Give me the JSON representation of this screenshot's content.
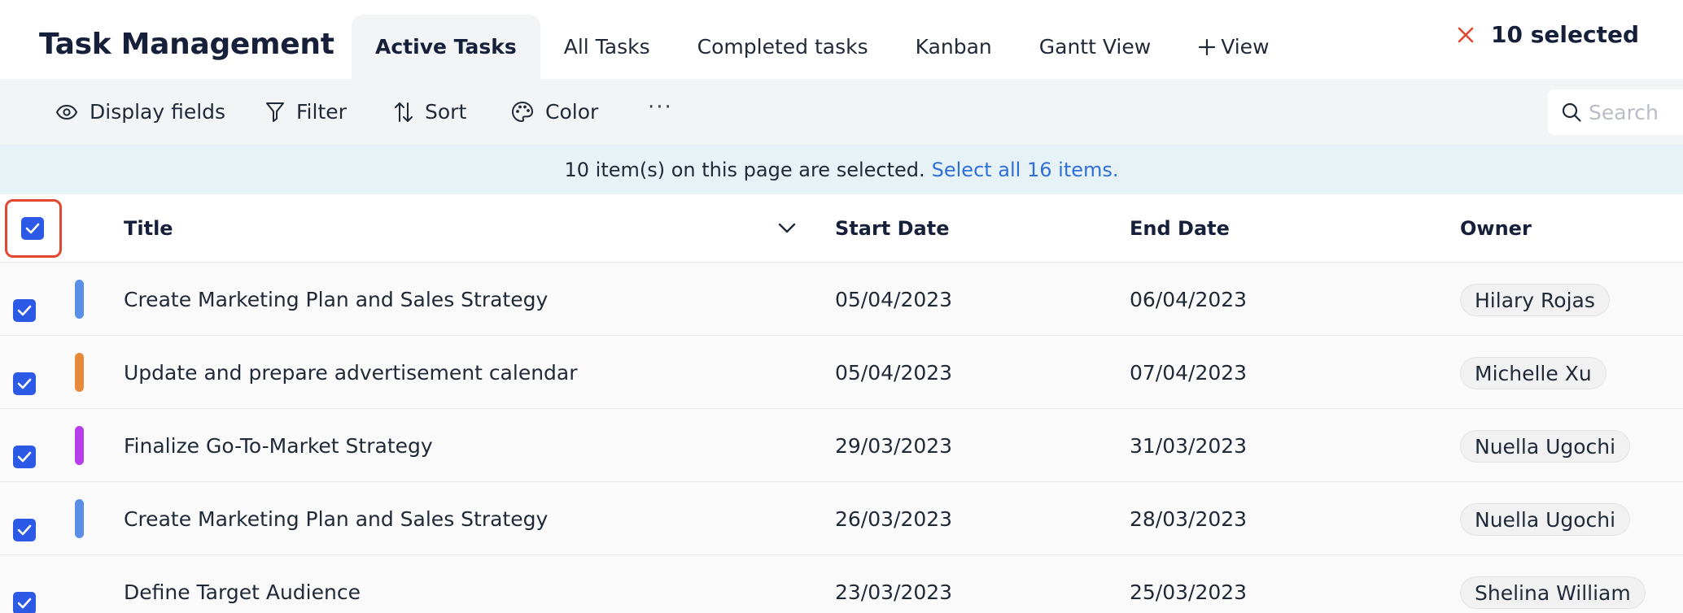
{
  "header": {
    "title": "Task Management",
    "tabs": [
      {
        "label": "Active Tasks",
        "active": true
      },
      {
        "label": "All Tasks",
        "active": false
      },
      {
        "label": "Completed tasks",
        "active": false
      },
      {
        "label": "Kanban",
        "active": false
      },
      {
        "label": "Gantt View",
        "active": false
      }
    ],
    "add_view_label": "View",
    "selected_text": "10 selected"
  },
  "toolbar": {
    "display_fields": "Display fields",
    "filter": "Filter",
    "sort": "Sort",
    "color": "Color",
    "more": "···",
    "search_placeholder": "Search"
  },
  "banner": {
    "text": "10 item(s) on this page are selected.",
    "link": "Select all 16 items."
  },
  "table": {
    "columns": {
      "title": "Title",
      "start_date": "Start Date",
      "end_date": "End Date",
      "owner": "Owner"
    },
    "rows": [
      {
        "title": "Create Marketing Plan and Sales Strategy",
        "start": "05/04/2023",
        "end": "06/04/2023",
        "owner": "Hilary Rojas",
        "color": "#5a8fe8",
        "checked": true
      },
      {
        "title": "Update and prepare advertisement calendar",
        "start": "05/04/2023",
        "end": "07/04/2023",
        "owner": "Michelle Xu",
        "color": "#e8893a",
        "checked": true
      },
      {
        "title": "Finalize Go-To-Market Strategy",
        "start": "29/03/2023",
        "end": "31/03/2023",
        "owner": "Nuella Ugochi",
        "color": "#b53ee8",
        "checked": true
      },
      {
        "title": "Create Marketing Plan and Sales Strategy",
        "start": "26/03/2023",
        "end": "28/03/2023",
        "owner": "Nuella Ugochi",
        "color": "#5a8fe8",
        "checked": true
      },
      {
        "title": "Define Target Audience",
        "start": "23/03/2023",
        "end": "25/03/2023",
        "owner": "Shelina William",
        "color": "",
        "checked": true
      }
    ]
  },
  "colors": {
    "accent": "#2c5ae6",
    "link": "#2e6fd8",
    "close": "#e2472f",
    "banner_bg": "#e7f2f7"
  }
}
